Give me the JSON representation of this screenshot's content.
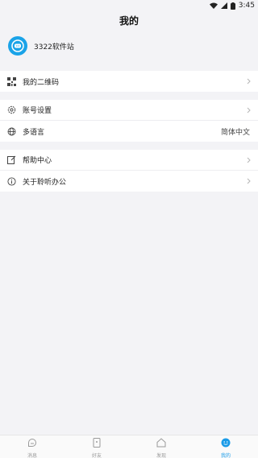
{
  "statusbar": {
    "time": "3:45"
  },
  "header": {
    "title": "我的"
  },
  "profile": {
    "name": "3322软件站"
  },
  "groups": [
    {
      "items": [
        {
          "label": "我的二维码",
          "icon": "qrcode-icon"
        }
      ]
    },
    {
      "items": [
        {
          "label": "账号设置",
          "icon": "gear-icon"
        },
        {
          "label": "多语言",
          "icon": "globe-icon",
          "value": "简体中文"
        }
      ]
    },
    {
      "items": [
        {
          "label": "帮助中心",
          "icon": "edit-icon"
        },
        {
          "label": "关于聆听办公",
          "icon": "info-icon"
        }
      ]
    }
  ],
  "tabbar": {
    "tabs": [
      {
        "label": "消息",
        "icon": "message-icon"
      },
      {
        "label": "好友",
        "icon": "friends-icon"
      },
      {
        "label": "发现",
        "icon": "discover-icon"
      },
      {
        "label": "我的",
        "icon": "me-icon",
        "active": true
      }
    ]
  },
  "colors": {
    "accent": "#1a9be8",
    "background": "#f3f3f6"
  }
}
